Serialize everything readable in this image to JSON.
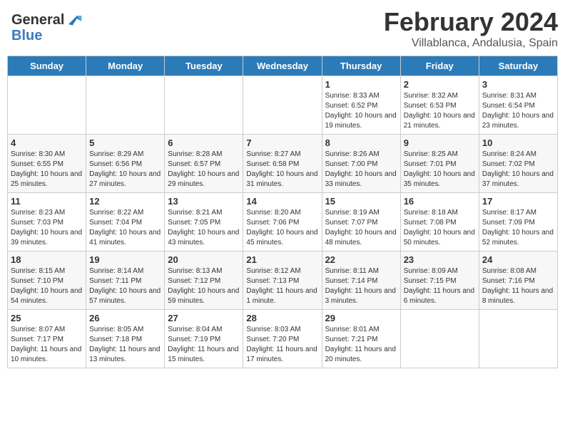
{
  "header": {
    "logo_general": "General",
    "logo_blue": "Blue",
    "title": "February 2024",
    "subtitle": "Villablanca, Andalusia, Spain"
  },
  "days_of_week": [
    "Sunday",
    "Monday",
    "Tuesday",
    "Wednesday",
    "Thursday",
    "Friday",
    "Saturday"
  ],
  "weeks": [
    [
      {
        "day": "",
        "info": ""
      },
      {
        "day": "",
        "info": ""
      },
      {
        "day": "",
        "info": ""
      },
      {
        "day": "",
        "info": ""
      },
      {
        "day": "1",
        "info": "Sunrise: 8:33 AM\nSunset: 6:52 PM\nDaylight: 10 hours and 19 minutes."
      },
      {
        "day": "2",
        "info": "Sunrise: 8:32 AM\nSunset: 6:53 PM\nDaylight: 10 hours and 21 minutes."
      },
      {
        "day": "3",
        "info": "Sunrise: 8:31 AM\nSunset: 6:54 PM\nDaylight: 10 hours and 23 minutes."
      }
    ],
    [
      {
        "day": "4",
        "info": "Sunrise: 8:30 AM\nSunset: 6:55 PM\nDaylight: 10 hours and 25 minutes."
      },
      {
        "day": "5",
        "info": "Sunrise: 8:29 AM\nSunset: 6:56 PM\nDaylight: 10 hours and 27 minutes."
      },
      {
        "day": "6",
        "info": "Sunrise: 8:28 AM\nSunset: 6:57 PM\nDaylight: 10 hours and 29 minutes."
      },
      {
        "day": "7",
        "info": "Sunrise: 8:27 AM\nSunset: 6:58 PM\nDaylight: 10 hours and 31 minutes."
      },
      {
        "day": "8",
        "info": "Sunrise: 8:26 AM\nSunset: 7:00 PM\nDaylight: 10 hours and 33 minutes."
      },
      {
        "day": "9",
        "info": "Sunrise: 8:25 AM\nSunset: 7:01 PM\nDaylight: 10 hours and 35 minutes."
      },
      {
        "day": "10",
        "info": "Sunrise: 8:24 AM\nSunset: 7:02 PM\nDaylight: 10 hours and 37 minutes."
      }
    ],
    [
      {
        "day": "11",
        "info": "Sunrise: 8:23 AM\nSunset: 7:03 PM\nDaylight: 10 hours and 39 minutes."
      },
      {
        "day": "12",
        "info": "Sunrise: 8:22 AM\nSunset: 7:04 PM\nDaylight: 10 hours and 41 minutes."
      },
      {
        "day": "13",
        "info": "Sunrise: 8:21 AM\nSunset: 7:05 PM\nDaylight: 10 hours and 43 minutes."
      },
      {
        "day": "14",
        "info": "Sunrise: 8:20 AM\nSunset: 7:06 PM\nDaylight: 10 hours and 45 minutes."
      },
      {
        "day": "15",
        "info": "Sunrise: 8:19 AM\nSunset: 7:07 PM\nDaylight: 10 hours and 48 minutes."
      },
      {
        "day": "16",
        "info": "Sunrise: 8:18 AM\nSunset: 7:08 PM\nDaylight: 10 hours and 50 minutes."
      },
      {
        "day": "17",
        "info": "Sunrise: 8:17 AM\nSunset: 7:09 PM\nDaylight: 10 hours and 52 minutes."
      }
    ],
    [
      {
        "day": "18",
        "info": "Sunrise: 8:15 AM\nSunset: 7:10 PM\nDaylight: 10 hours and 54 minutes."
      },
      {
        "day": "19",
        "info": "Sunrise: 8:14 AM\nSunset: 7:11 PM\nDaylight: 10 hours and 57 minutes."
      },
      {
        "day": "20",
        "info": "Sunrise: 8:13 AM\nSunset: 7:12 PM\nDaylight: 10 hours and 59 minutes."
      },
      {
        "day": "21",
        "info": "Sunrise: 8:12 AM\nSunset: 7:13 PM\nDaylight: 11 hours and 1 minute."
      },
      {
        "day": "22",
        "info": "Sunrise: 8:11 AM\nSunset: 7:14 PM\nDaylight: 11 hours and 3 minutes."
      },
      {
        "day": "23",
        "info": "Sunrise: 8:09 AM\nSunset: 7:15 PM\nDaylight: 11 hours and 6 minutes."
      },
      {
        "day": "24",
        "info": "Sunrise: 8:08 AM\nSunset: 7:16 PM\nDaylight: 11 hours and 8 minutes."
      }
    ],
    [
      {
        "day": "25",
        "info": "Sunrise: 8:07 AM\nSunset: 7:17 PM\nDaylight: 11 hours and 10 minutes."
      },
      {
        "day": "26",
        "info": "Sunrise: 8:05 AM\nSunset: 7:18 PM\nDaylight: 11 hours and 13 minutes."
      },
      {
        "day": "27",
        "info": "Sunrise: 8:04 AM\nSunset: 7:19 PM\nDaylight: 11 hours and 15 minutes."
      },
      {
        "day": "28",
        "info": "Sunrise: 8:03 AM\nSunset: 7:20 PM\nDaylight: 11 hours and 17 minutes."
      },
      {
        "day": "29",
        "info": "Sunrise: 8:01 AM\nSunset: 7:21 PM\nDaylight: 11 hours and 20 minutes."
      },
      {
        "day": "",
        "info": ""
      },
      {
        "day": "",
        "info": ""
      }
    ]
  ]
}
